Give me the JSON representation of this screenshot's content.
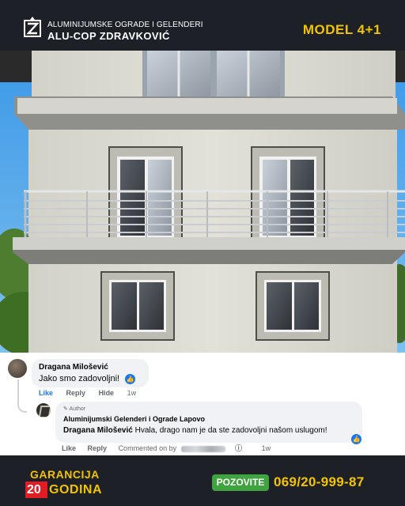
{
  "header": {
    "company_subtitle": "ALUMINIJUMSKE OGRADE I GELENDERI",
    "company_name": "ALU-COP ZDRAVKOVIĆ",
    "model_label": "MODEL 4+1",
    "logo_icon": "z-logo-icon"
  },
  "photo": {
    "subject": "house-facade-with-aluminium-balcony-railing",
    "colors": {
      "sky": "#4aa3e8",
      "wall": "#dcdbd2",
      "railing": "#c9ccd0",
      "slab": "#cfcfcb"
    }
  },
  "comments": [
    {
      "author": "Dragana Milošević",
      "text": "Jako smo zadovoljni!",
      "reaction_icon": "like-icon",
      "actions": {
        "like": "Like",
        "reply": "Reply",
        "hide": "Hide",
        "time": "1w"
      }
    },
    {
      "author_tag": "Author",
      "author": "Aluminijumski Gelenderi i Ograde Lapovo",
      "mention": "Dragana Milošević",
      "text": " Hvala, drago nam je da ste zadovoljni našom uslugom!",
      "reaction_icon": "like-icon",
      "actions": {
        "like": "Like",
        "reply": "Reply",
        "commented_on_by": "Commented on by",
        "time": "1w"
      }
    }
  ],
  "footer": {
    "guarantee_line1": "GARANCIJA",
    "guarantee_years": "20",
    "guarantee_line2": "GODINA",
    "call_button": "POZOVITE",
    "phone": "069/20-999-87",
    "colors": {
      "accent": "#f2c300",
      "red": "#e31b23",
      "green": "#3fa43f"
    }
  }
}
